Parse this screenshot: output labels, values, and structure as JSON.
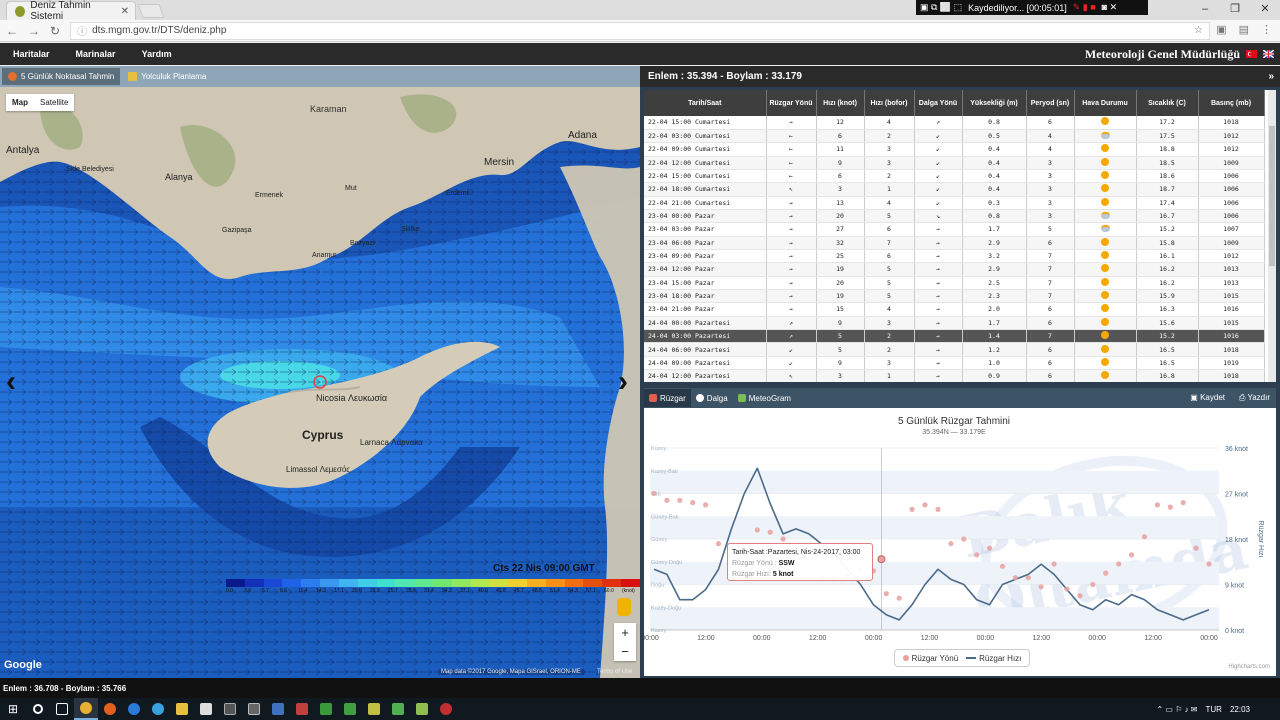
{
  "browser": {
    "tab_title": "Deniz Tahmin Sistemi",
    "url": "dts.mgm.gov.tr/DTS/deniz.php",
    "recording_text": "Kaydediliyor... [00:05:01]"
  },
  "site": {
    "menu": [
      "Haritalar",
      "Marinalar",
      "Yardım"
    ],
    "brand": "Meteoroloji Genel Müdürlüğü"
  },
  "left": {
    "tabs": [
      "5 Günlük Noktasal Tahmin",
      "Yolculuk Planlama"
    ],
    "map_types": [
      "Map",
      "Satellite"
    ],
    "labels": {
      "antalya": "Antalya",
      "side": "Side Belediyesi",
      "alanya": "Alanya",
      "karaman": "Karaman",
      "mersin": "Mersin",
      "adana": "Adana",
      "nicosia": "Nicosia\nΛευκωσία",
      "cyprus": "Cyprus",
      "larnaca": "Larnaca\nΛάρνακα",
      "limassol": "Limassol\nΛεμεσός",
      "mut": "Mut",
      "erdemli": "Erdemli",
      "silifke": "Silifke",
      "ermenek": "Ermenek",
      "anamur": "Anamur",
      "gazipasa": "Gazipaşa",
      "bozyazi": "Bozyazı"
    },
    "timestamp": "Cts 22 Nis 09:00 GMT",
    "legend_values": [
      "0.0",
      "2.9",
      "5.7",
      "8.6",
      "11.4",
      "14.3",
      "17.1",
      "20.0",
      "22.9",
      "25.7",
      "28.6",
      "31.4",
      "34.3",
      "37.1",
      "40.0",
      "42.8",
      "45.7",
      "48.6",
      "51.4",
      "54.3",
      "57.1",
      "60.0",
      "(knot)"
    ],
    "legend_colors": [
      "#0b1a8a",
      "#1230b8",
      "#1848d8",
      "#1f62e8",
      "#2c7ef0",
      "#3a98f0",
      "#3fb4f0",
      "#40cde8",
      "#40e0d0",
      "#50e8b0",
      "#60e890",
      "#70e870",
      "#90e860",
      "#b0e850",
      "#d0e040",
      "#f0d030",
      "#f8b020",
      "#f89018",
      "#f07010",
      "#e85010",
      "#e03010",
      "#d81010"
    ],
    "attribution": "Map data ©2017 Google, Mapa GISrael, ORION-ME",
    "terms": "Terms of Use",
    "google": "Google",
    "coord_footer": "Enlem : 36.708 - Boylam : 35.766"
  },
  "right": {
    "coord_header": "Enlem : 35.394 - Boylam : 33.179",
    "columns": [
      "Tarih/Saat",
      "Rüzgar Yönü",
      "Hızı (knot)",
      "Hızı (bofor)",
      "Dalga Yönü",
      "Yüksekliği (m)",
      "Peryod (sn)",
      "Hava Durumu",
      "Sıcaklık (C)",
      "Basınç (mb)"
    ],
    "rows": [
      [
        "22-04 15:00 Cumartesi",
        "→",
        "12",
        "4",
        "↗",
        "0.8",
        "6",
        "sun",
        "17.2",
        "1018"
      ],
      [
        "22-04 03:00 Cumartesi",
        "←",
        "6",
        "2",
        "↙",
        "0.5",
        "4",
        "cloud",
        "17.5",
        "1012"
      ],
      [
        "22-04 09:00 Cumartesi",
        "←",
        "11",
        "3",
        "↙",
        "0.4",
        "4",
        "sun",
        "18.8",
        "1012"
      ],
      [
        "22-04 12:00 Cumartesi",
        "←",
        "9",
        "3",
        "↙",
        "0.4",
        "3",
        "sun",
        "18.5",
        "1009"
      ],
      [
        "22-04 15:00 Cumartesi",
        "←",
        "6",
        "2",
        "↙",
        "0.4",
        "3",
        "sun",
        "18.6",
        "1006"
      ],
      [
        "22-04 18:00 Cumartesi",
        "↖",
        "3",
        "1",
        "↙",
        "0.4",
        "3",
        "sun",
        "18.7",
        "1006"
      ],
      [
        "22-04 21:00 Cumartesi",
        "→",
        "13",
        "4",
        "↙",
        "0.3",
        "3",
        "sun",
        "17.4",
        "1006"
      ],
      [
        "23-04 00:00 Pazar",
        "→",
        "20",
        "5",
        "↘",
        "0.8",
        "3",
        "cloud",
        "16.7",
        "1006"
      ],
      [
        "23-04 03:00 Pazar",
        "→",
        "27",
        "6",
        "→",
        "1.7",
        "5",
        "cloud",
        "15.2",
        "1007"
      ],
      [
        "23-04 06:00 Pazar",
        "→",
        "32",
        "7",
        "→",
        "2.9",
        "6",
        "sun",
        "15.8",
        "1009"
      ],
      [
        "23-04 09:00 Pazar",
        "→",
        "25",
        "6",
        "→",
        "3.2",
        "7",
        "sun",
        "16.1",
        "1012"
      ],
      [
        "23-04 12:00 Pazar",
        "→",
        "19",
        "5",
        "→",
        "2.9",
        "7",
        "sun",
        "16.2",
        "1013"
      ],
      [
        "23-04 15:00 Pazar",
        "→",
        "20",
        "5",
        "→",
        "2.5",
        "7",
        "sun",
        "16.2",
        "1013"
      ],
      [
        "23-04 18:00 Pazar",
        "→",
        "19",
        "5",
        "→",
        "2.3",
        "7",
        "sun",
        "15.9",
        "1015"
      ],
      [
        "23-04 21:00 Pazar",
        "→",
        "15",
        "4",
        "→",
        "2.0",
        "6",
        "sun",
        "16.3",
        "1016"
      ],
      [
        "24-04 00:00 Pazartesi",
        "↗",
        "9",
        "3",
        "→",
        "1.7",
        "6",
        "sun",
        "15.6",
        "1015"
      ],
      [
        "24-04 03:00 Pazartesi",
        "↗",
        "5",
        "2",
        "→",
        "1.4",
        "7",
        "sun",
        "15.2",
        "1016"
      ],
      [
        "24-04 06:00 Pazartesi",
        "↙",
        "5",
        "2",
        "→",
        "1.2",
        "6",
        "sun",
        "16.5",
        "1018"
      ],
      [
        "24-04 09:00 Pazartesi",
        "↙",
        "9",
        "3",
        "→",
        "1.0",
        "6",
        "sun",
        "16.5",
        "1019"
      ],
      [
        "24-04 12:00 Pazartesi",
        "↖",
        "3",
        "1",
        "→",
        "0.9",
        "6",
        "sun",
        "16.8",
        "1018"
      ]
    ],
    "highlight_row": 16,
    "chart_tabs": [
      "Rüzgar",
      "Dalga",
      "MeteoGram"
    ],
    "chart_actions": [
      "Kaydet",
      "Yazdır"
    ],
    "tooltip": {
      "time": "Tarih-Saat :Pazartesi, Nis-24-2017, 03:00",
      "dir_label": "Rüzgar Yönü :",
      "dir_value": "SSW",
      "speed_label": "Rüzgar Hızı:",
      "speed_value": "5 knot"
    },
    "highcharts": "Highcharts.com",
    "watermark": "Balık Oltamda"
  },
  "chart_data": {
    "type": "line",
    "title": "5 Günlük Rüzgar Tahmini",
    "subtitle": "35.394N — 33.179E",
    "x_labels": [
      "00:00",
      "12:00",
      "00:00",
      "12:00",
      "00:00",
      "12:00",
      "00:00",
      "12:00",
      "00:00",
      "12:00",
      "00:00"
    ],
    "y_ticks": [
      "0 knot",
      "9 knot",
      "18 knot",
      "27 knot",
      "36 knot"
    ],
    "ylim": [
      0,
      36
    ],
    "ylabel": "Rüzgar Hızı",
    "dir_bands": [
      "Kuzey",
      "Kuzey-Doğu",
      "Doğu",
      "Güney-Doğu",
      "Güney",
      "Güney-Batı",
      "Batı",
      "Kuzey-Batı",
      "Kuzey"
    ],
    "series": [
      {
        "name": "Rüzgar Yönü",
        "values": [
          6.0,
          5.7,
          5.7,
          5.6,
          5.5,
          3.8,
          2.6,
          3.4,
          4.4,
          4.3,
          4.0,
          3.3,
          3.7,
          2.3,
          2.3,
          2.4,
          2.7,
          2.6,
          1.6,
          1.4,
          5.3,
          5.5,
          5.3,
          3.8,
          4.0,
          3.3,
          3.6,
          2.8,
          2.3,
          2.3,
          1.9,
          2.9,
          1.8,
          1.5,
          2.0,
          2.5,
          2.9,
          3.3,
          4.1,
          5.5,
          5.4,
          5.6,
          3.6,
          2.9
        ]
      },
      {
        "name": "Rüzgar Hızı",
        "values": [
          12,
          11,
          6,
          6,
          8,
          12,
          20,
          27,
          32,
          25,
          19,
          20,
          19,
          17,
          15,
          12,
          9,
          5,
          3,
          2,
          5,
          9,
          12,
          10,
          9,
          6,
          5,
          9,
          10,
          11,
          13,
          11,
          8,
          5,
          4,
          6,
          5,
          7,
          6,
          4,
          3,
          2,
          3,
          4
        ]
      }
    ],
    "legend": [
      "Rüzgar Yönü",
      "Rüzgar Hızı"
    ],
    "time_axis_note": "12:00"
  },
  "taskbar": {
    "lang": "TUR",
    "time": "22:03"
  }
}
